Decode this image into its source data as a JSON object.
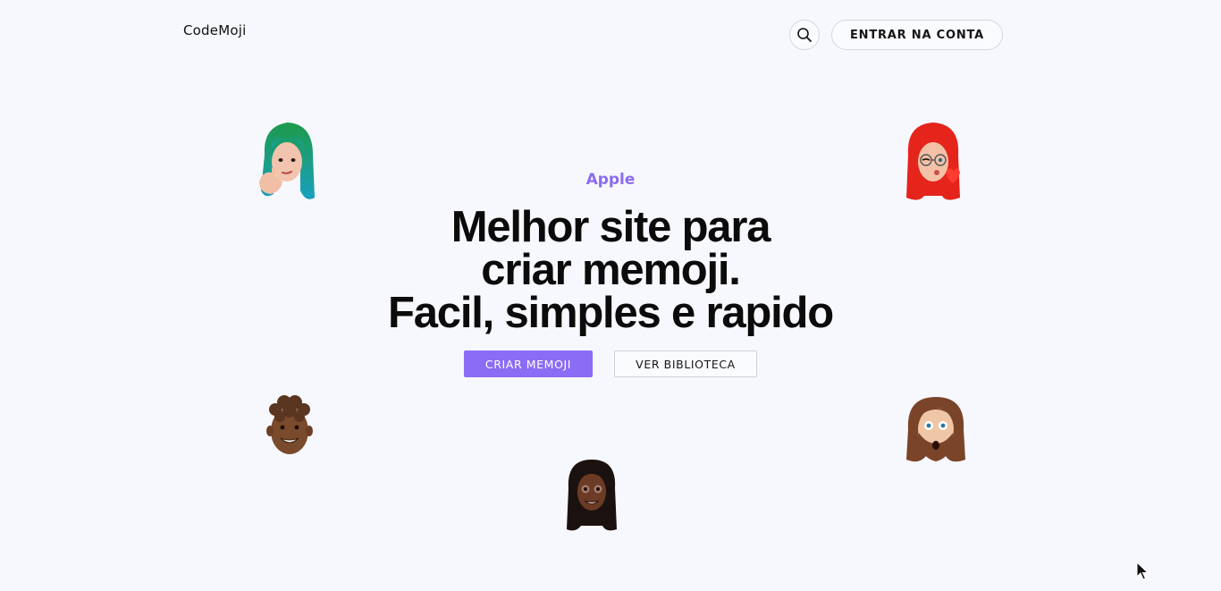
{
  "header": {
    "logo_text": "CodeMoji",
    "search_icon": "search-icon",
    "login_label": "ENTRAR NA CONTA"
  },
  "hero": {
    "eyebrow": "Apple",
    "headline_lines": [
      "Melhor site para",
      "criar memoji.",
      "Facil, simples e rapido"
    ],
    "primary_cta": "CRIAR MEMOJI",
    "secondary_cta": "VER BIBLIOTECA"
  },
  "memojis": [
    {
      "name": "memoji-green-hair-thinking",
      "hair": "#1d9a4a",
      "hair2": "#1aa0c0",
      "skin": "#f2c4ad"
    },
    {
      "name": "memoji-red-hair-glasses-heart",
      "hair": "#e5241b",
      "skin": "#f3c1a6"
    },
    {
      "name": "memoji-curly-hair-smiling",
      "hair": "#5a3520",
      "skin": "#7a4a2c"
    },
    {
      "name": "memoji-long-hair-beard-surprised",
      "hair": "#7a4428",
      "skin": "#f0c7a6"
    },
    {
      "name": "memoji-long-black-hair-smiling",
      "hair": "#1b1210",
      "skin": "#6b3b25"
    }
  ],
  "colors": {
    "accent": "#8a6cf5",
    "eyebrow": "#8b6cf0",
    "background": "#f7f8fd",
    "text": "#0b0b0b"
  }
}
